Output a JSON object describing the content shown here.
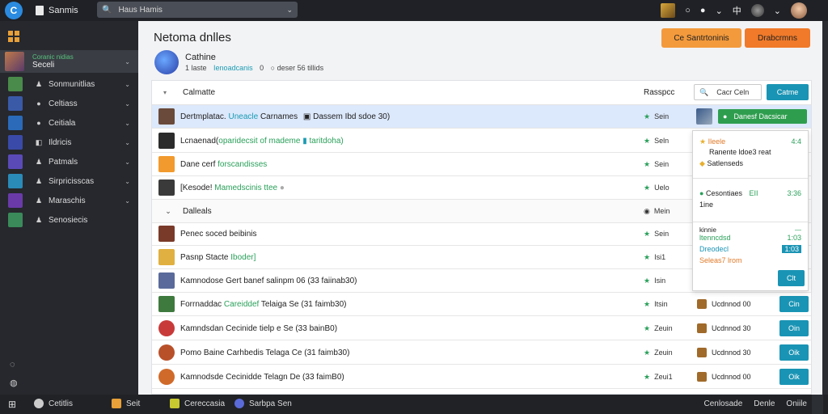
{
  "topbar": {
    "logo_glyph": "C",
    "app_title": "Sanmis",
    "search_value": "Haus Hamis",
    "icons": [
      "thumb",
      "circle-icon",
      "record-icon",
      "chevron-down-icon",
      "settings-icon",
      "avatar-icon",
      "chevron-down-icon",
      "user-avatar"
    ]
  },
  "sidebar": {
    "active": {
      "tag": "Coranic nidias",
      "label": "Seceli"
    },
    "items": [
      {
        "label": "Sonmunitlias"
      },
      {
        "label": "Celtiass"
      },
      {
        "label": "Ceitiala"
      },
      {
        "label": "Ildricis"
      },
      {
        "label": "Patmals"
      },
      {
        "label": "Sirpricisscas"
      },
      {
        "label": "Maraschis"
      },
      {
        "label": "Senosiecis"
      }
    ]
  },
  "main": {
    "title": "Netoma dnlles",
    "buttons": {
      "primary": "Ce Santrtoninis",
      "secondary": "Drabcrmns"
    },
    "collection": {
      "name": "Cathine",
      "count": "1 laste",
      "badge": "Ienoadcanis",
      "sep": "0",
      "meta": "deser 56 tillids"
    }
  },
  "table": {
    "header": {
      "name": "Calmatte",
      "response": "Rasspcc",
      "filter_placeholder": "Cacr Celn",
      "go_label": "Catme"
    },
    "rows": [
      {
        "t1": "Dertmplatac.",
        "hl": "Uneacle",
        "t2": "Carnames",
        "meta": "Dassem Ibd sdoe 30)",
        "status": "Sein",
        "thumb": "#6a4a3a",
        "sel": true
      },
      {
        "t1": "Lcnaenad(",
        "hl": "oparidecsit of mademe",
        "t2": "",
        "meta": "taritdoha)",
        "status": "Seln",
        "thumb": "#2c2c2c"
      },
      {
        "t1": "Dane cerf",
        "hl": "forscandisses",
        "t2": "",
        "meta": "",
        "status": "Sein",
        "thumb": "#f29a2e"
      },
      {
        "t1": "[Kesode!",
        "hl": "Mamedscinis",
        "t2": "ttee",
        "meta": "",
        "status": "Uelo",
        "thumb": "#3a3a3a"
      },
      {
        "t1": "Dalleals",
        "hl": "",
        "t2": "",
        "meta": "",
        "status": "Mein",
        "group": true
      },
      {
        "t1": "Penec soced beibinis",
        "hl": "",
        "t2": "",
        "meta": "",
        "status": "Sein",
        "thumb": "#7a3a2a"
      },
      {
        "t1": "Pasnp Stacte",
        "hl": "",
        "t2": "",
        "meta": "Iboder]",
        "status": "Isi1",
        "thumb": "#e0b040"
      },
      {
        "t1": "Kamnodose Gert banef",
        "hl": "",
        "t2": "",
        "meta": "salinpm 06 (33 faiinab30)",
        "status": "Isin",
        "thumb": "#5a6a9a"
      },
      {
        "t1": "Forrnaddac",
        "hl": "Careiddef",
        "t2": "",
        "meta": "Telaiga Se (31 faimb30)",
        "status": "Itsin",
        "thumb": "#3e7a3e",
        "gb": "Ucdnnod 00",
        "btn": "Cin"
      },
      {
        "t1": "Kamndsdan",
        "hl": "",
        "t2": "Cecinide tielp",
        "meta": "e Se (33 bainB0)",
        "status": "Zeuin",
        "thumb": "#c83a3a",
        "gb": "Ucdnnod 30",
        "btn": "Oin"
      },
      {
        "t1": "Pomo Baine",
        "hl": "",
        "t2": "Carhbedis Telaga",
        "meta": "Ce (31 faimb30)",
        "status": "Zeuin",
        "thumb": "#b8502a",
        "gb": "Ucdnnod 30",
        "btn": "Oik"
      },
      {
        "t1": "Kamnodsde",
        "hl": "",
        "t2": "Cecinidde Telagn",
        "meta": "De (33 faimB0)",
        "status": "Zeui1",
        "thumb": "#d06a2a",
        "gb": "Ucdnnod 00",
        "btn": "Oik"
      }
    ],
    "sel_button": "Danesf   Dacsicar"
  },
  "popover": {
    "s1_title": "Ileele",
    "s1_val": "4:4",
    "s1_line": "Ranente ldoe3 reat",
    "s1_link": "Satlenseds",
    "s2_label": "Cesontiaes",
    "s2_mid": "EII",
    "s2_val": "3:36",
    "s2_sub": "1ine",
    "s3_t1": "kinnie",
    "s3_t2": "ltenncdsd",
    "s3_t3": "Dreodecl",
    "s3_t4": "Seleas7 lrom",
    "s3_v1": "1:03",
    "s3_v2": "1:03",
    "button": "Clt"
  },
  "taskbar": {
    "items": [
      "Cetitlis",
      "Seit",
      "Cereccasia",
      "Sarbpa Sen"
    ],
    "right": [
      "Cenlosade",
      "Denle",
      "Oniile"
    ]
  },
  "colors": {
    "accent": "#1a94b4",
    "orange": "#f07a2a",
    "green": "#2aa05a",
    "selected": "#dce8fb"
  }
}
